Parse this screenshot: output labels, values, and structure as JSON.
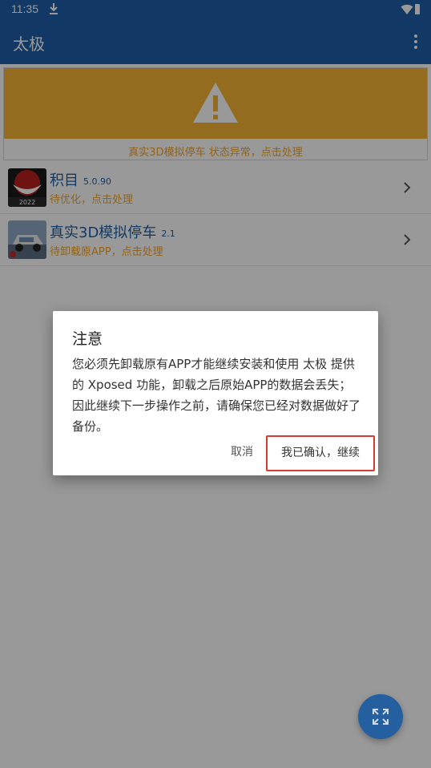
{
  "status_bar": {
    "time": "11:35"
  },
  "app_bar": {
    "title": "太极"
  },
  "warning": {
    "text": "真实3D模拟停车 状态异常，点击处理"
  },
  "apps": [
    {
      "name": "积目",
      "version": "5.0.90",
      "status": "待优化，点击处理",
      "icon_label": "2022"
    },
    {
      "name": "真实3D模拟停车",
      "version": "2.1",
      "status": "待卸载原APP，点击处理"
    }
  ],
  "dialog": {
    "title": "注意",
    "message": "您必须先卸载原有APP才能继续安装和使用 太极 提供的 Xposed 功能，卸载之后原始APP的数据会丢失；因此继续下一步操作之前，请确保您已经对数据做好了备份。",
    "cancel_label": "取消",
    "confirm_label": "我已确认，继续"
  },
  "colors": {
    "primary": "#1f5fa8",
    "warning_banner": "#f6b435",
    "warning_text": "#f4a52a",
    "highlight_border": "#d63b2f"
  },
  "fab": {
    "icon": "fullscreen-expand-icon"
  }
}
